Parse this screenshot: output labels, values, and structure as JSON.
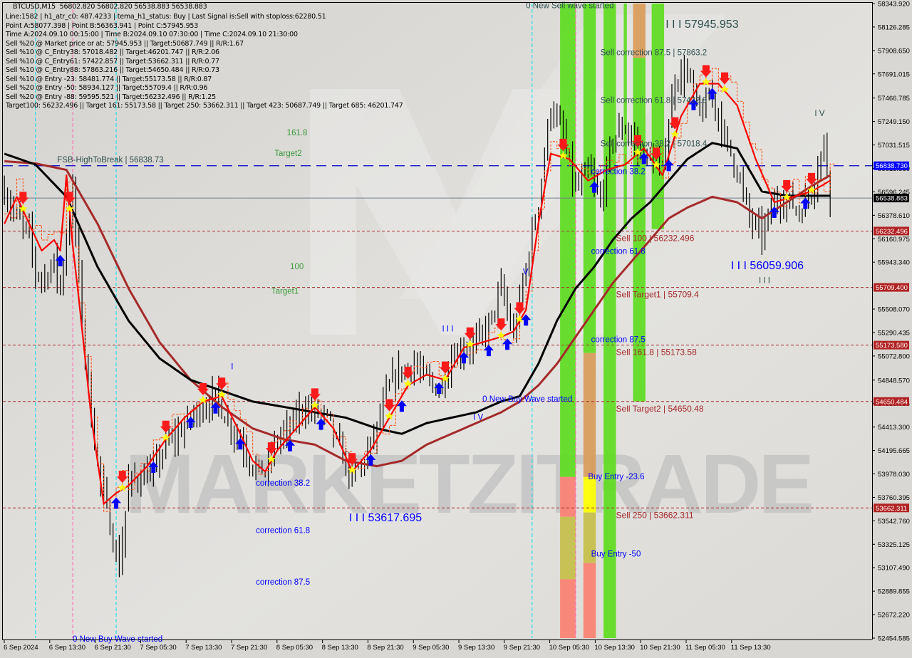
{
  "window": {
    "symbol_timeframe": "BTCUSD,M15",
    "ohlc": "56802.820 56802.820 56538.883 56538.883"
  },
  "info_lines": [
    "Line:1582 | h1_atr_c0: 487.4233 | tema_h1_status: Buy | Last Signal is:Sell with stoploss:62280.51",
    "Point A:58077.398 | Point B:56363.941 | Point C:57945.953",
    "Time A:2024.09.10 00:15:00 | Time B:2024.09.10 07:30:00 | Time C:2024.09.10 21:30:00",
    "Sell %20 @ Market price or at: 57945.953 || Target:50687.749 || R/R:1.67",
    "Sell %10 @ C_Entry38: 57018.482 || Target:46201.747 || R/R:2.06",
    "Sell %10 @ C_Entry61: 57422.857 || Target:53662.311 || R/R:0.77",
    "Sell %10 @ C_Entry88: 57863.216 || Target:54650.484 || R/R:0.73",
    "Sell %10 @ Entry -23: 58481.774 || Target:55173.58 || R/R:0.87",
    "Sell %20 @ Entry -50: 58934.127 || Target:55709.4 || R/R:0.96",
    "Sell %20 @ Entry -88: 59595.521 || Target:56232.496 || R/R:1.25",
    "Target100: 56232.496 || Target 161: 55173.58 || Target 250: 53662.311 || Target 423: 50687.749 || Target 685: 46201.747"
  ],
  "watermark": "MARKETZITRADE",
  "colors": {
    "background": "#d9d7d3",
    "candles": "#000000",
    "fast_ma": "#ff0000",
    "slow_ma_black": "#000000",
    "slow_ma_brown": "#a52a2a",
    "level_line": "#a52a2a",
    "fsb_line": "#0000cc",
    "current_price_line": "#708090",
    "cyan_vline": "#00e5ee",
    "pink_vline": "#ff69b4",
    "label_blue": "#0000ff",
    "label_green": "#3a9a3a",
    "label_dark": "#2f4f4f",
    "label_red": "#a52a2a",
    "band_green": "#5ddc1f",
    "band_green_dark": "#3cbf38",
    "band_salmon": "#fa8072",
    "band_orange": "#d99b5a",
    "band_olive": "#c5bf4a",
    "band_yellow": "#ffff00",
    "price_tag_blue": "#0000ff",
    "price_tag_red": "#b22222",
    "price_tag_black": "#000000"
  },
  "chart_data": {
    "type": "line",
    "title": "BTCUSD,M15",
    "xlabel": "",
    "ylabel": "",
    "ylim": [
      52454.585,
      58343.92
    ],
    "grid": false,
    "x_ticks": [
      "6 Sep 2024",
      "6 Sep 13:30",
      "6 Sep 21:30",
      "7 Sep 05:30",
      "7 Sep 13:30",
      "7 Sep 21:30",
      "8 Sep 05:30",
      "8 Sep 13:30",
      "8 Sep 21:30",
      "9 Sep 05:30",
      "9 Sep 13:30",
      "9 Sep 21:30",
      "10 Sep 05:30",
      "10 Sep 13:30",
      "10 Sep 21:30",
      "11 Sep 05:30",
      "11 Sep 13:30"
    ],
    "y_ticks": [
      58343.92,
      58126.285,
      57908.65,
      57691.015,
      57466.785,
      57249.15,
      57031.515,
      56813.88,
      56596.245,
      56378.61,
      56160.975,
      55943.34,
      55508.07,
      55290.435,
      55072.8,
      54848.57,
      54630.935,
      54413.3,
      54195.665,
      53978.03,
      53760.395,
      53542.76,
      53325.125,
      53107.49,
      52889.855,
      52672.22,
      52454.585
    ],
    "price_tags": [
      {
        "value": 56838.73,
        "label": "56838.730",
        "style": "blue"
      },
      {
        "value": 56538.883,
        "label": "56538.883",
        "style": "black"
      },
      {
        "value": 56232.496,
        "label": "56232.496",
        "style": "red"
      },
      {
        "value": 55709.4,
        "label": "55709.400",
        "style": "red"
      },
      {
        "value": 55173.58,
        "label": "55173.580",
        "style": "red"
      },
      {
        "value": 54650.484,
        "label": "54650.484",
        "style": "red"
      },
      {
        "value": 53662.311,
        "label": "53662.311",
        "style": "red"
      }
    ],
    "horizontal_levels": [
      {
        "value": 56838.73,
        "kind": "fsb",
        "label": "FSB-HighToBreak | 56838.73"
      },
      {
        "value": 56538.883,
        "kind": "current"
      },
      {
        "value": 56232.496,
        "kind": "target",
        "label": "Sell 100 | 56232.496"
      },
      {
        "value": 55709.4,
        "kind": "target",
        "label": "Sell Target1 | 55709.4"
      },
      {
        "value": 55173.58,
        "kind": "target",
        "label": "Sell 161.8 | 55173.58"
      },
      {
        "value": 54650.484,
        "kind": "target",
        "label": "Sell Target2 | 54650.48"
      },
      {
        "value": 53662.311,
        "kind": "target",
        "label": "Sell  250 | 53662.311"
      }
    ],
    "price_path": {
      "x_index": [
        0,
        4,
        8,
        10,
        13,
        16,
        18,
        20,
        22,
        25,
        28,
        31,
        34,
        37,
        40,
        44,
        48,
        52,
        56,
        60,
        64,
        68,
        72,
        76,
        80,
        84,
        88,
        92,
        96,
        100,
        104,
        108,
        112,
        116,
        120,
        124,
        128,
        132,
        136,
        140,
        144,
        148,
        152,
        156,
        160,
        164,
        168,
        172,
        176,
        180,
        184,
        188,
        192,
        196,
        200,
        204,
        208,
        212,
        216,
        220,
        224,
        228,
        232,
        236,
        240,
        244,
        248,
        252,
        256,
        260,
        264,
        266
      ],
      "close": [
        56600,
        56350,
        56200,
        55850,
        55800,
        55950,
        55700,
        56200,
        56600,
        55400,
        54500,
        53900,
        53500,
        53100,
        53900,
        53950,
        54000,
        54250,
        54350,
        54500,
        54600,
        54700,
        54450,
        54300,
        54050,
        54000,
        54300,
        54400,
        54600,
        54550,
        54500,
        54200,
        53950,
        54100,
        54400,
        54800,
        54950,
        55000,
        54850,
        54750,
        55050,
        55150,
        55200,
        55350,
        55700,
        55250,
        55900,
        56500,
        57400,
        57100,
        56600,
        56800,
        56500,
        57100,
        57200,
        57000,
        56900,
        56800,
        57650,
        57700,
        57300,
        57500,
        57100,
        56800,
        56350,
        56200,
        56500,
        56550,
        56400,
        56600,
        57050,
        56540
      ]
    },
    "fast_ma": {
      "x_index": [
        0,
        4,
        8,
        12,
        16,
        18,
        20,
        22,
        24,
        28,
        32,
        36,
        40,
        46,
        52,
        58,
        64,
        70,
        76,
        80,
        84,
        88,
        94,
        100,
        106,
        112,
        118,
        124,
        130,
        136,
        142,
        148,
        154,
        160,
        164,
        168,
        172,
        176,
        182,
        188,
        194,
        200,
        206,
        212,
        218,
        224,
        230,
        236,
        242,
        248,
        254,
        260,
        266
      ],
      "value": [
        56300,
        56550,
        56300,
        56050,
        56150,
        56050,
        56750,
        56100,
        55600,
        54500,
        53700,
        53800,
        53870,
        54050,
        54300,
        54500,
        54650,
        54700,
        54350,
        54100,
        54000,
        54200,
        54400,
        54600,
        54400,
        54000,
        54200,
        54500,
        54800,
        54900,
        54850,
        55150,
        55200,
        55250,
        55300,
        55500,
        56300,
        56950,
        56900,
        56700,
        56800,
        56850,
        57000,
        56750,
        57300,
        57600,
        57600,
        57400,
        56900,
        56500,
        56550,
        56600,
        56700
      ]
    },
    "slow_ma_black": {
      "x_index": [
        0,
        10,
        20,
        30,
        40,
        50,
        60,
        70,
        80,
        90,
        100,
        110,
        120,
        128,
        136,
        144,
        152,
        160,
        166,
        172,
        178,
        184,
        190,
        196,
        202,
        208,
        214,
        220,
        228,
        236,
        244,
        252,
        260,
        266
      ],
      "value": [
        56950,
        56850,
        56550,
        55900,
        55400,
        55050,
        54850,
        54750,
        54650,
        54600,
        54550,
        54500,
        54400,
        54350,
        54450,
        54500,
        54550,
        54650,
        54700,
        55000,
        55400,
        55700,
        55900,
        56150,
        56350,
        56500,
        56700,
        56900,
        57050,
        57000,
        56600,
        56560,
        56560,
        56560
      ]
    },
    "slow_ma_brown": {
      "x_index": [
        0,
        10,
        20,
        30,
        40,
        50,
        60,
        70,
        80,
        90,
        100,
        110,
        120,
        128,
        136,
        144,
        152,
        160,
        166,
        172,
        178,
        184,
        190,
        196,
        202,
        208,
        214,
        220,
        228,
        236,
        244,
        252,
        260,
        266
      ],
      "value": [
        56880,
        56860,
        56800,
        56300,
        55700,
        55200,
        54850,
        54600,
        54400,
        54300,
        54250,
        54100,
        54050,
        54100,
        54250,
        54350,
        54450,
        54550,
        54650,
        54800,
        55000,
        55250,
        55500,
        55750,
        55950,
        56150,
        56350,
        56450,
        56550,
        56500,
        56350,
        56500,
        56650,
        56750
      ]
    },
    "vertical_markers": [
      {
        "x_index": 10,
        "color": "cyan"
      },
      {
        "x_index": 22,
        "color": "pink"
      },
      {
        "x_index": 36,
        "color": "cyan"
      },
      {
        "x_index": 170,
        "color": "cyan"
      },
      {
        "x_index": 184,
        "color": "pink"
      }
    ],
    "annotations": [
      {
        "text": "0 New Sell wave started",
        "x_index": 168,
        "value": 58300,
        "color": "dark"
      },
      {
        "text": "I I I 57945.953",
        "x_index": 213,
        "value": 58120,
        "color": "dark",
        "size": "large"
      },
      {
        "text": "Sell correction 87.5 | 57863.2",
        "x_index": 192,
        "value": 57863.2,
        "color": "dark"
      },
      {
        "text": "Sell correction 61.8 | 57422.8",
        "x_index": 192,
        "value": 57422.8,
        "color": "dark"
      },
      {
        "text": "Sell correction 38.2 | 57018.4",
        "x_index": 192,
        "value": 57018.4,
        "color": "dark"
      },
      {
        "text": "correction 38.2",
        "x_index": 189,
        "value": 56760,
        "color": "blue"
      },
      {
        "text": "correction 61.8",
        "x_index": 189,
        "value": 56020,
        "color": "blue"
      },
      {
        "text": "correction 87.5",
        "x_index": 189,
        "value": 55200,
        "color": "blue"
      },
      {
        "text": "I I I 56059.906",
        "x_index": 234,
        "value": 55880,
        "color": "blue",
        "size": "large"
      },
      {
        "text": "I I I",
        "x_index": 243,
        "value": 55750,
        "color": "dark"
      },
      {
        "text": "I V",
        "x_index": 261,
        "value": 57300,
        "color": "dark"
      },
      {
        "text": "161.8",
        "x_index": 91,
        "value": 57120,
        "color": "green"
      },
      {
        "text": "Target2",
        "x_index": 87,
        "value": 56930,
        "color": "green"
      },
      {
        "text": "100",
        "x_index": 92,
        "value": 55880,
        "color": "green"
      },
      {
        "text": "Target1",
        "x_index": 86,
        "value": 55650,
        "color": "green"
      },
      {
        "text": "FSB-HighToBreak | 56838.73",
        "x_index": 17,
        "value": 56870,
        "color": "dark"
      },
      {
        "text": "V",
        "x_index": 167,
        "value": 55830,
        "color": "blue"
      },
      {
        "text": "I I I",
        "x_index": 141,
        "value": 55300,
        "color": "blue"
      },
      {
        "text": "0 New Buy Wave started",
        "x_index": 154,
        "value": 54650,
        "color": "blue"
      },
      {
        "text": "I V",
        "x_index": 151,
        "value": 54480,
        "color": "blue"
      },
      {
        "text": "I",
        "x_index": 73,
        "value": 54950,
        "color": "blue"
      },
      {
        "text": "correction 38.2",
        "x_index": 81,
        "value": 53870,
        "color": "blue"
      },
      {
        "text": "correction 61.8",
        "x_index": 81,
        "value": 53430,
        "color": "blue"
      },
      {
        "text": "correction 87.5",
        "x_index": 81,
        "value": 52950,
        "color": "blue"
      },
      {
        "text": "I I I 53617.695",
        "x_index": 111,
        "value": 53540,
        "color": "blue",
        "size": "large"
      },
      {
        "text": "Buy Entry -23.6",
        "x_index": 188,
        "value": 53930,
        "color": "blue"
      },
      {
        "text": "Buy Entry -50",
        "x_index": 189,
        "value": 53210,
        "color": "blue"
      },
      {
        "text": "0 New Buy Wave started",
        "x_index": 22,
        "value": 52420,
        "color": "blue"
      }
    ],
    "bands": [
      {
        "x_index": 179.5,
        "width_bars": 5,
        "segments": [
          {
            "from": 58343.9,
            "to": 53950,
            "color": "green"
          },
          {
            "from": 53950,
            "to": 53580,
            "color": "salmon"
          },
          {
            "from": 53580,
            "to": 53000,
            "color": "olive"
          },
          {
            "from": 53000,
            "to": 52454.6,
            "color": "salmon"
          }
        ]
      },
      {
        "x_index": 187,
        "width_bars": 4,
        "segments": [
          {
            "from": 58343.9,
            "to": 55100,
            "color": "green"
          },
          {
            "from": 55100,
            "to": 53950,
            "color": "orange"
          },
          {
            "from": 53950,
            "to": 53620,
            "color": "yellow"
          },
          {
            "from": 53620,
            "to": 53150,
            "color": "olive"
          },
          {
            "from": 53150,
            "to": 52454.6,
            "color": "salmon"
          }
        ]
      },
      {
        "x_index": 193.5,
        "width_bars": 4,
        "segments": [
          {
            "from": 58343.9,
            "to": 52454.6,
            "color": "green"
          }
        ]
      },
      {
        "x_index": 200,
        "width_bars": 1,
        "segments": [
          {
            "from": 58343.9,
            "to": 56250,
            "color": "green"
          }
        ]
      },
      {
        "x_index": 203,
        "width_bars": 4,
        "segments": [
          {
            "from": 58343.9,
            "to": 57840,
            "color": "orange"
          },
          {
            "from": 57840,
            "to": 56250,
            "color": "green"
          },
          {
            "from": 56250,
            "to": 54650,
            "color": "green"
          }
        ]
      },
      {
        "x_index": 209,
        "width_bars": 4,
        "segments": [
          {
            "from": 58343.9,
            "to": 56250,
            "color": "green"
          }
        ]
      }
    ]
  }
}
